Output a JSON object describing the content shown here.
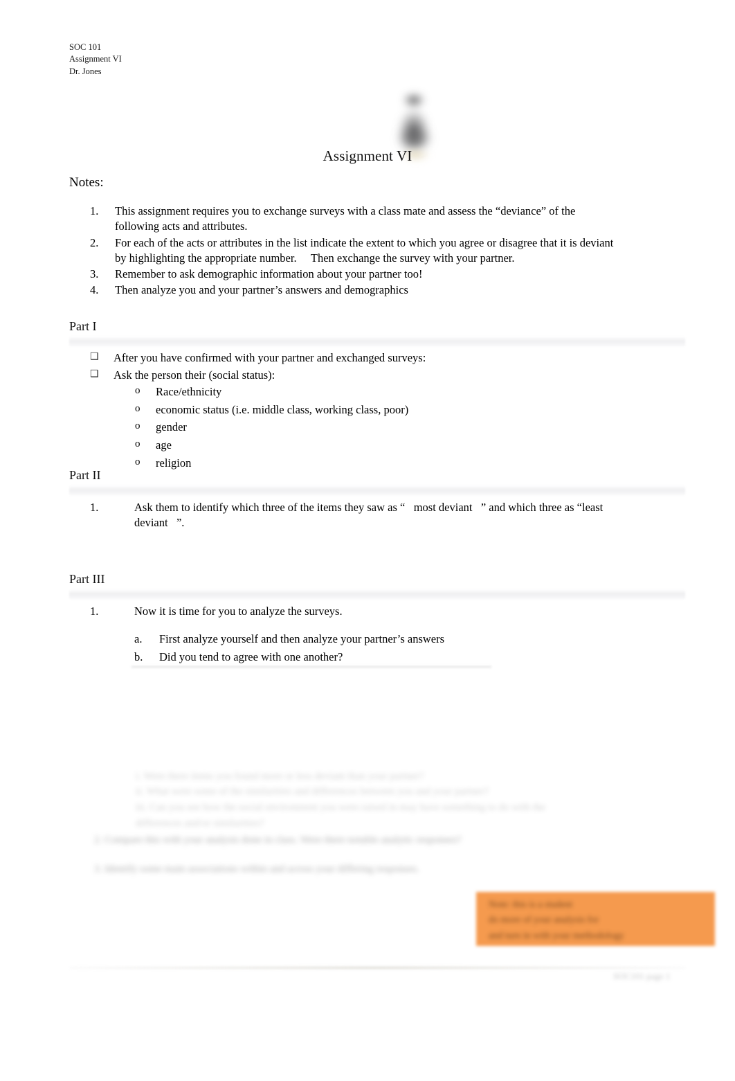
{
  "document": {
    "course_header": [
      "SOC 101",
      "Assignment VI",
      "Dr. Jones"
    ],
    "title": "Assignment VI",
    "notes_label": "Notes:",
    "notes": [
      {
        "marker": "1.",
        "text": "This assignment requires you to exchange surveys with a class mate and assess the “deviance” of the following acts and attributes."
      },
      {
        "marker": "2.",
        "text": "For each of the acts or attributes in the list indicate the extent to which you agree or disagree that it is deviant by highlighting the appropriate number.  Then exchange the survey with your partner."
      },
      {
        "marker": "3.",
        "text": "Remember to ask demographic information about your partner too!"
      },
      {
        "marker": "4.",
        "text": "Then analyze you and your partner’s answers and demographics"
      }
    ],
    "part_one": {
      "heading": "Part I",
      "bullets": [
        {
          "marker": "❑",
          "text": "After you have confirmed with your partner and exchanged surveys:"
        },
        {
          "marker": "❑",
          "text": "Ask the person their (social status):"
        }
      ],
      "sub_items": [
        {
          "marker": "o",
          "text": "Race/ethnicity"
        },
        {
          "marker": "o",
          "text": "economic status (i.e. middle class, working class, poor)"
        },
        {
          "marker": "o",
          "text": "gender"
        },
        {
          "marker": "o",
          "text": "age"
        },
        {
          "marker": "o",
          "text": "religion"
        }
      ]
    },
    "part_two": {
      "heading": "Part II",
      "item_marker": "1.",
      "item_text": "Ask them to identify which three of the items they saw as “  most deviant  ” and which three as “least deviant  ”."
    },
    "part_three": {
      "heading": "Part III",
      "item_marker": "1.",
      "item_text": "Now it is time for you to analyze the surveys.",
      "sub_items": [
        {
          "marker": "a.",
          "text": "First  analyze yourself and then analyze your partner’s answers"
        },
        {
          "marker": "b.",
          "text": "Did you tend to agree with one another?"
        }
      ]
    },
    "obscured": {
      "note": "illegible",
      "sub_lines": [
        "i.    Were there items you found more or less deviant than your partner?",
        "ii.   What were some of the similarities and differences between you and your partner?",
        "iii.  Can you see how the social environment you were raised in may have something to do with the differences and/or similarities?"
      ],
      "lines": [
        "2.   Compare this with your analysis done in class. Were there notable analytic responses?",
        "3.   Identify some main associations within and across your differing responses."
      ],
      "highlight_box": [
        "Note: this is a student",
        "do more of your analysis for",
        "and turn in with your methodology"
      ],
      "footer": "SOC101 page 1"
    },
    "colors": {
      "highlight_orange": "#f59a4e",
      "band_gray": "#eeeef0",
      "text_black": "#000000"
    }
  }
}
